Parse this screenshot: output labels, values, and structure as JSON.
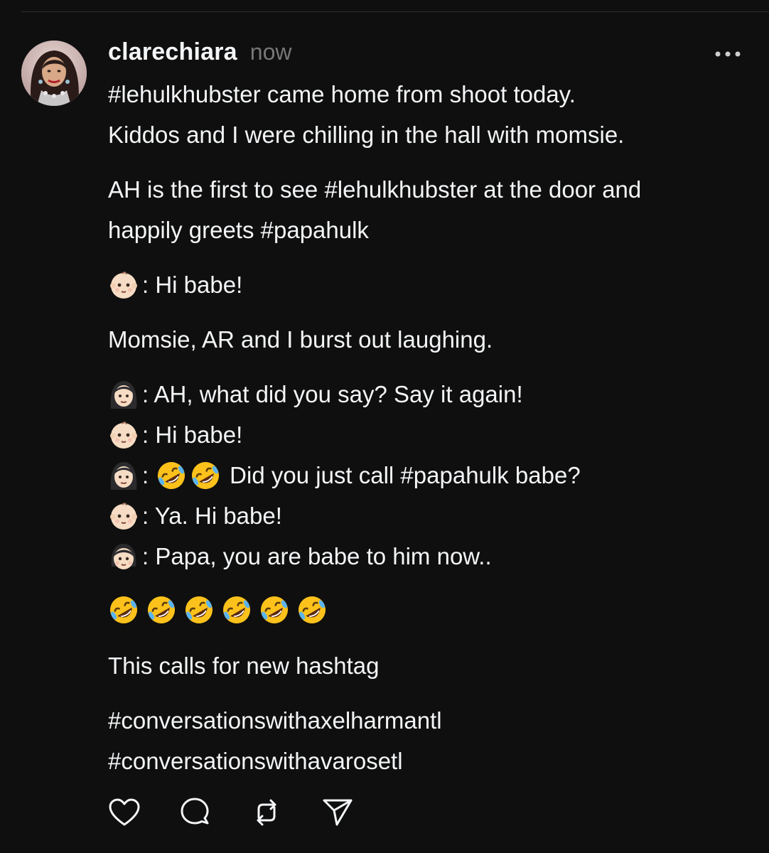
{
  "post": {
    "username": "clarechiara",
    "timestamp": "now",
    "lines": [
      {
        "type": "text",
        "text": "#lehulkhubster came home from shoot today."
      },
      {
        "type": "text",
        "text": "Kiddos and I were chilling in the hall with momsie."
      },
      {
        "type": "gap"
      },
      {
        "type": "text",
        "text": "AH is the first to see #lehulkhubster at the door and"
      },
      {
        "type": "text",
        "text": "happily greets #papahulk"
      },
      {
        "type": "gap"
      },
      {
        "type": "speaker",
        "icon": "baby-emoji-icon",
        "text": ": Hi babe!"
      },
      {
        "type": "gap"
      },
      {
        "type": "text",
        "text": "Momsie, AR and I burst out laughing."
      },
      {
        "type": "gap"
      },
      {
        "type": "speaker",
        "icon": "woman-emoji-icon",
        "text": ": AH, what did you say? Say it again!"
      },
      {
        "type": "speaker",
        "icon": "baby-emoji-icon",
        "text": ": Hi babe!"
      },
      {
        "type": "speaker-laugh",
        "icon": "woman-emoji-icon",
        "text": "Did you just call #papahulk babe?"
      },
      {
        "type": "speaker",
        "icon": "baby-emoji-icon",
        "text": ": Ya. Hi babe!"
      },
      {
        "type": "speaker",
        "icon": "girl-emoji-icon",
        "text": ": Papa, you are babe to him now.."
      },
      {
        "type": "gap"
      },
      {
        "type": "laugh-row",
        "count": 6
      },
      {
        "type": "gap"
      },
      {
        "type": "text",
        "text": "This calls for new hashtag"
      },
      {
        "type": "gap"
      },
      {
        "type": "text",
        "text": "#conversationswithaxelharmantl"
      },
      {
        "type": "text",
        "text": "#conversationswithavarosetl"
      }
    ]
  },
  "actions": [
    {
      "name": "like-button",
      "icon": "heart-icon"
    },
    {
      "name": "reply-button",
      "icon": "comment-icon"
    },
    {
      "name": "repost-button",
      "icon": "repost-icon"
    },
    {
      "name": "share-button",
      "icon": "send-icon"
    }
  ],
  "colors": {
    "background": "#0f0f0f",
    "text": "#f3f5f7",
    "muted": "#777777"
  }
}
